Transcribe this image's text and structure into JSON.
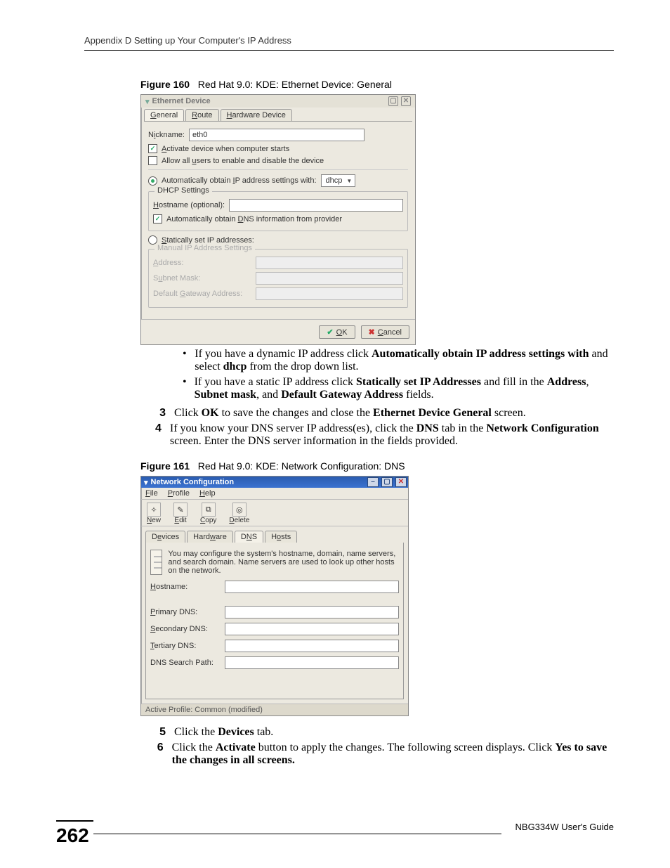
{
  "header": {
    "running": "Appendix D Setting up Your Computer's IP Address"
  },
  "figure160": {
    "label": "Figure 160",
    "caption": "Red Hat 9.0: KDE: Ethernet Device: General",
    "dialog": {
      "title": "Ethernet Device",
      "tabs": {
        "general": "General",
        "route": "Route",
        "hardware": "Hardware Device"
      },
      "nickname_label": "Nickname:",
      "nickname_value": "eth0",
      "activate_label": "Activate device when computer starts",
      "allow_label": "Allow all users to enable and disable the device",
      "auto_ip_label": "Automatically obtain IP address settings with:",
      "auto_ip_value": "dhcp",
      "dhcp_group": "DHCP Settings",
      "hostname_label": "Hostname (optional):",
      "auto_dns_label": "Automatically obtain DNS information from provider",
      "static_label": "Statically set IP addresses:",
      "manual_group": "Manual IP Address Settings",
      "address_label": "Address:",
      "subnet_label": "Subnet Mask:",
      "gateway_label": "Default Gateway Address:",
      "ok": "OK",
      "cancel": "Cancel"
    }
  },
  "instructions1": {
    "bullet1_pre": "If you have a dynamic IP address click ",
    "bullet1_b1": "Automatically obtain IP address settings with",
    "bullet1_mid": " and select ",
    "bullet1_b2": "dhcp",
    "bullet1_post": " from the drop down list.",
    "bullet2_pre": "If you have a static IP address click ",
    "bullet2_b1": "Statically set IP Addresses",
    "bullet2_mid": " and fill in the ",
    "bullet2_b2": "Address",
    "bullet2_c": ", ",
    "bullet2_b3": "Subnet mask",
    "bullet2_c2": ", and ",
    "bullet2_b4": "Default Gateway Address",
    "bullet2_post": " fields.",
    "step3_pre": "Click ",
    "step3_b1": "OK",
    "step3_mid": " to save the changes and close the ",
    "step3_b2": "Ethernet Device General",
    "step3_post": " screen.",
    "step4_pre": "If you know your DNS server IP address(es), click the ",
    "step4_b1": "DNS",
    "step4_mid": " tab in the ",
    "step4_b2": "Network Configuration",
    "step4_post": " screen. Enter the DNS server information in the fields provided."
  },
  "figure161": {
    "label": "Figure 161",
    "caption": "Red Hat 9.0: KDE: Network Configuration: DNS",
    "dialog": {
      "title": "Network Configuration",
      "menus": {
        "file": "File",
        "profile": "Profile",
        "help": "Help"
      },
      "toolbar": {
        "new": "New",
        "edit": "Edit",
        "copy": "Copy",
        "delete": "Delete"
      },
      "tabs": {
        "devices": "Devices",
        "hardware": "Hardware",
        "dns": "DNS",
        "hosts": "Hosts"
      },
      "desc": "You may configure the system's hostname, domain, name servers, and search domain. Name servers are used to look up other hosts on the network.",
      "hostname": "Hostname:",
      "primary": "Primary DNS:",
      "secondary": "Secondary DNS:",
      "tertiary": "Tertiary DNS:",
      "search": "DNS Search Path:",
      "status": "Active Profile: Common (modified)"
    }
  },
  "instructions2": {
    "step5_pre": "Click the ",
    "step5_b1": "Devices",
    "step5_post": " tab.",
    "step6_pre": "Click the ",
    "step6_b1": "Activate",
    "step6_mid": " button to apply the changes. The following screen displays. Click ",
    "step6_b2": "Yes to save the changes in all screens."
  },
  "footer": {
    "pagenum": "262",
    "guide": "NBG334W User's Guide"
  }
}
